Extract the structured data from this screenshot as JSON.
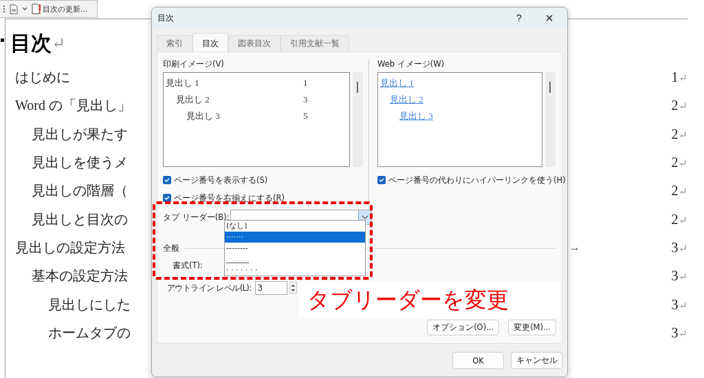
{
  "toolbar": {
    "update_button": "目次の更新..."
  },
  "document": {
    "heading": "目次",
    "paragraph_mark": "↵",
    "entries": [
      {
        "text": "はじめに",
        "page": "1"
      },
      {
        "text": "Word の「見出し」",
        "page": "2",
        "children": [
          {
            "text": "見出しが果たす",
            "page": "2"
          },
          {
            "text": "見出しを使うメ",
            "page": "2"
          },
          {
            "text": "見出しの階層（",
            "page": "2"
          },
          {
            "text": "見出しと目次の",
            "page": "2"
          }
        ]
      },
      {
        "text": "見出しの設定方法",
        "page": "3",
        "tab_mark": "→",
        "children": [
          {
            "text": "基本の設定方法",
            "page": "3",
            "children": [
              {
                "text": "見出しにした",
                "page": "3"
              },
              {
                "text": "ホームタブの",
                "page": "3"
              }
            ]
          }
        ]
      }
    ]
  },
  "dialog": {
    "title": "目次",
    "help": "?",
    "close": "×",
    "tabs": [
      {
        "label": "索引",
        "selected": false
      },
      {
        "label": "目次",
        "selected": true
      },
      {
        "label": "図表目次",
        "selected": false
      },
      {
        "label": "引用文献一覧",
        "selected": false
      }
    ],
    "print_preview": {
      "label": "印刷イメージ(V)",
      "lines": [
        {
          "text": "見出し 1",
          "page": "1"
        },
        {
          "text": "見出し 2",
          "page": "3"
        },
        {
          "text": "見出し 3",
          "page": "5"
        }
      ]
    },
    "web_preview": {
      "label": "Web イメージ(W)",
      "links": [
        "見出し 1",
        "見出し 2",
        "見出し 3"
      ]
    },
    "checkboxes_left": [
      {
        "label": "ページ番号を表示する(S)",
        "checked": true
      },
      {
        "label": "ページ番号を右揃えにする(R)",
        "checked": true
      }
    ],
    "checkbox_right": {
      "label": "ページ番号の代わりにハイパーリンクを使う(H)",
      "checked": true
    },
    "tab_leader": {
      "label": "タブ リーダー(B):",
      "options": [
        {
          "text": "(なし)",
          "selected": false
        },
        {
          "text": "·······",
          "selected": true
        },
        {
          "text": "--------",
          "selected": false
        },
        {
          "text": "______",
          "selected": false
        },
        {
          "text": "· · · · · · ·",
          "selected": false
        }
      ]
    },
    "general": {
      "label": "全般",
      "format_label": "書式(T):",
      "outline_label": "アウトライン レベル(L):",
      "outline_value": "3"
    },
    "buttons_middle": [
      "オプション(O)...",
      "変更(M)..."
    ],
    "buttons_bottom": [
      "OK",
      "キャンセル"
    ]
  },
  "annotation": {
    "text": "タブリーダーを変更"
  }
}
